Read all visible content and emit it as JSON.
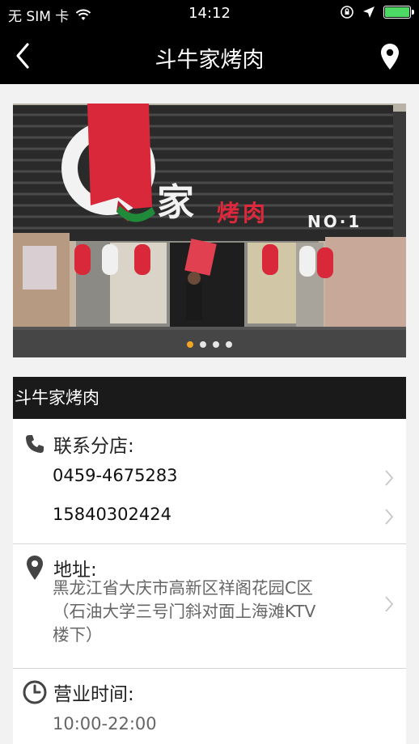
{
  "status_bar": {
    "carrier": "无 SIM 卡",
    "time": "14:12"
  },
  "nav": {
    "title": "斗牛家烤肉",
    "back_icon": "chevron-left-icon",
    "location_icon": "map-pin-icon"
  },
  "carousel": {
    "sign": {
      "char": "家",
      "subtitle": "烤肉",
      "number": "NO·1"
    },
    "active_index": 0,
    "count": 4
  },
  "store": {
    "name": "斗牛家烤肉",
    "contact": {
      "label": "联系分店:",
      "phones": [
        "0459-4675283",
        "15840302424"
      ]
    },
    "address": {
      "label": "地址:",
      "lines": [
        "黑龙江省大庆市高新区祥阁花园C区",
        "（石油大学三号门斜对面上海滩KTV",
        "楼下）"
      ]
    },
    "hours": {
      "label": "营业时间:",
      "value": "10:00-22:00"
    }
  },
  "colors": {
    "bar": "#000000",
    "name_bar": "#1a1a1a",
    "accent_dot": "#f5a623",
    "battery": "#4cd964",
    "sign_red": "#e0283c"
  }
}
